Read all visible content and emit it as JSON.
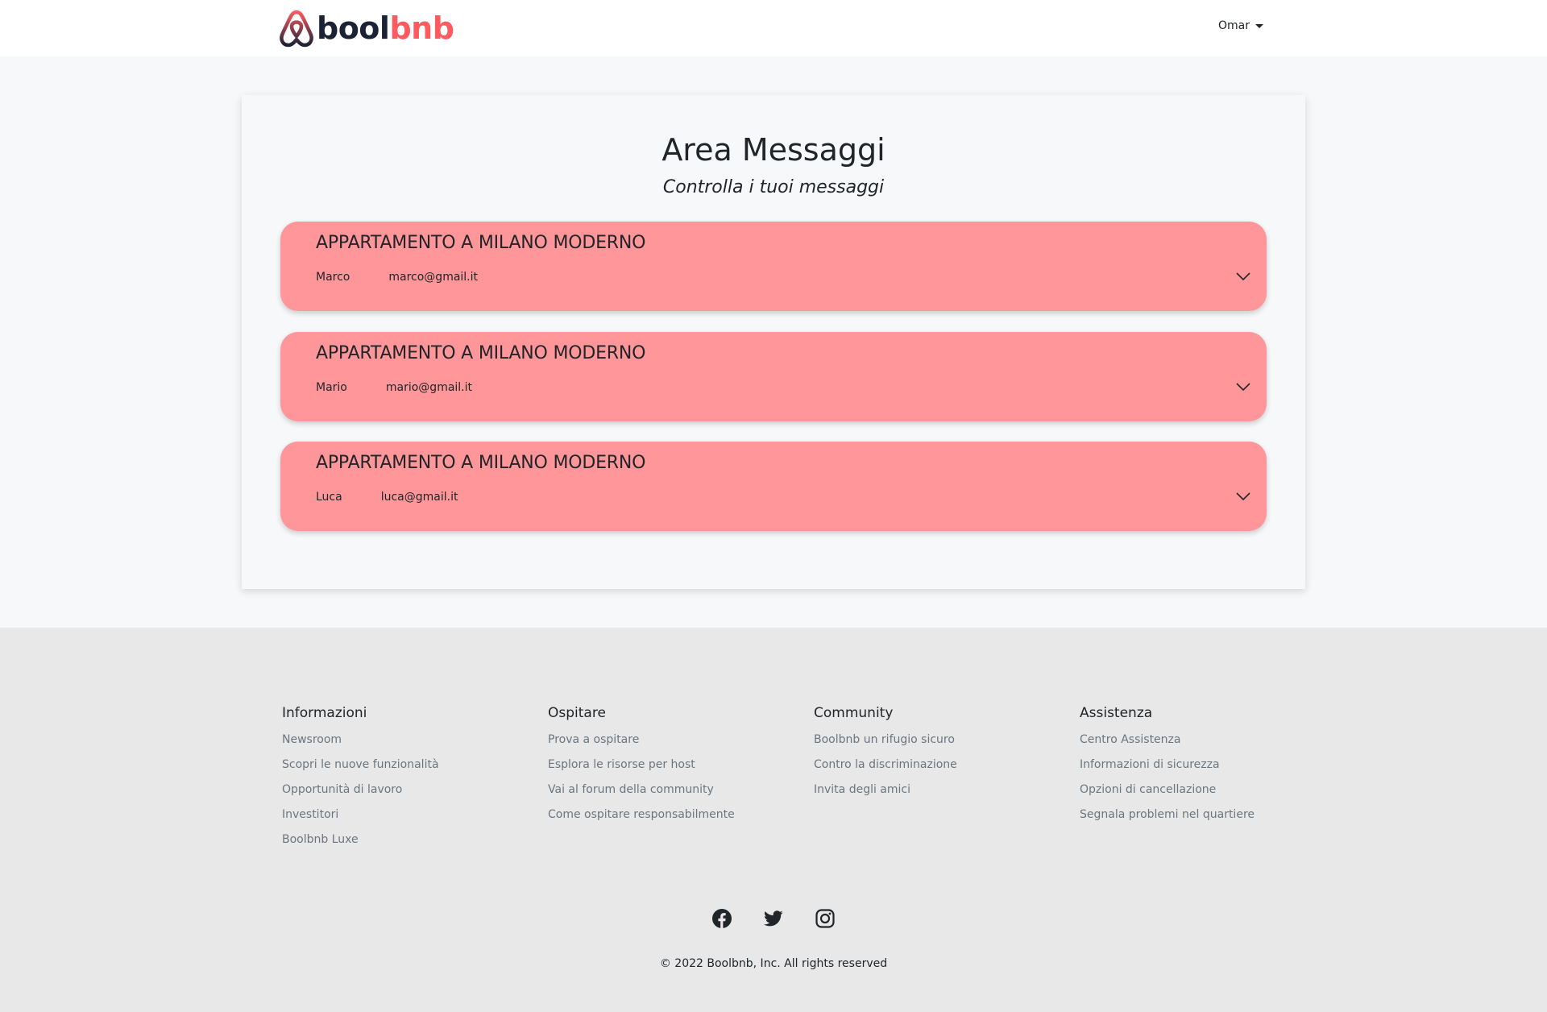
{
  "header": {
    "logo_part1": "bool",
    "logo_part2": "bnb",
    "user_name": "Omar",
    "brand_color": "#ff5a5f"
  },
  "main": {
    "title": "Area Messaggi",
    "subtitle": "Controlla i tuoi messaggi",
    "messages": [
      {
        "title": "APPARTAMENTO A MILANO MODERNO",
        "name": "Marco",
        "email": "marco@gmail.it"
      },
      {
        "title": "APPARTAMENTO A MILANO MODERNO",
        "name": "Mario",
        "email": "mario@gmail.it"
      },
      {
        "title": "APPARTAMENTO A MILANO MODERNO",
        "name": "Luca",
        "email": "luca@gmail.it"
      }
    ],
    "card_color": "#ff9699"
  },
  "footer": {
    "columns": [
      {
        "heading": "Informazioni",
        "links": [
          "Newsroom",
          "Scopri le nuove funzionalità",
          "Opportunità di lavoro",
          "Investitori",
          "Boolbnb Luxe"
        ]
      },
      {
        "heading": "Ospitare",
        "links": [
          "Prova a ospitare",
          "Esplora le risorse per host",
          "Vai al forum della community",
          "Come ospitare responsabilmente"
        ]
      },
      {
        "heading": "Community",
        "links": [
          "Boolbnb un rifugio sicuro",
          "Contro la discriminazione",
          "Invita degli amici"
        ]
      },
      {
        "heading": "Assistenza",
        "links": [
          "Centro Assistenza",
          "Informazioni di sicurezza",
          "Opzioni di cancellazione",
          "Segnala problemi nel quartiere"
        ]
      }
    ],
    "social_icons": [
      "facebook-icon",
      "twitter-icon",
      "instagram-icon"
    ],
    "copyright": "© 2022 Boolbnb, Inc. All rights reserved"
  }
}
